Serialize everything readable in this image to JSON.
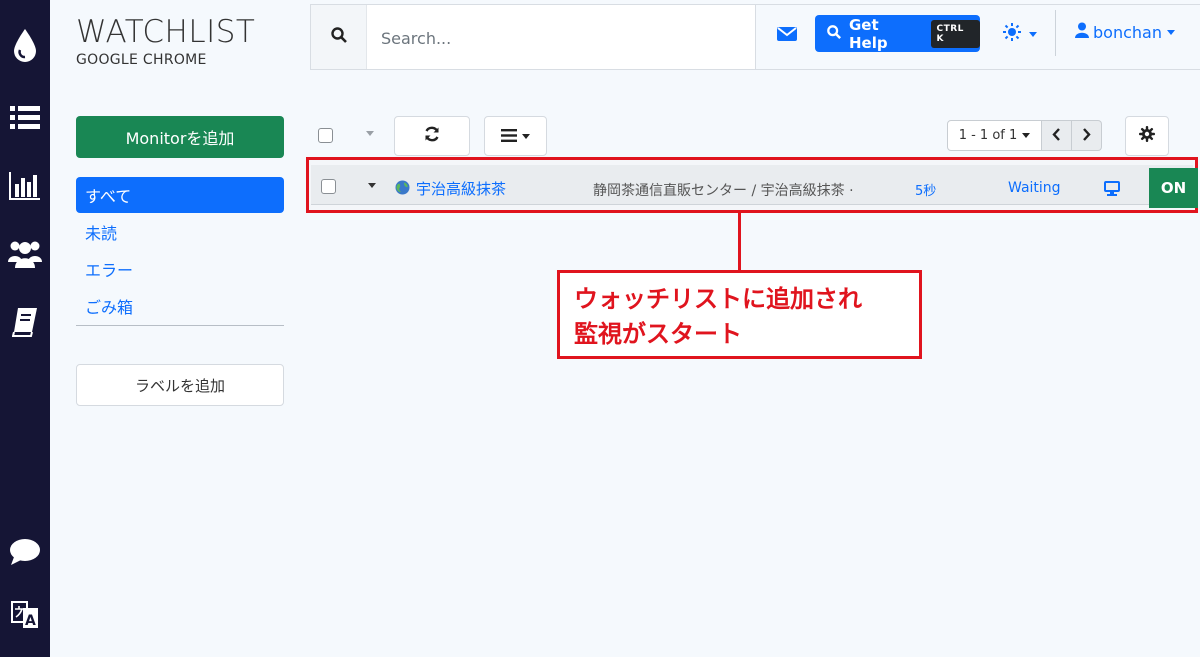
{
  "app": {
    "title": "WATCHLIST",
    "subtitle": "GOOGLE CHROME"
  },
  "rail": {
    "icons": [
      "droplet-logo-icon",
      "list-icon",
      "chart-icon",
      "users-icon",
      "book-icon",
      "chat-icon",
      "translate-icon"
    ]
  },
  "header": {
    "search_placeholder": "Search...",
    "help_label": "Get Help",
    "help_shortcut": "CTRL K",
    "username": "bonchan"
  },
  "sidebar": {
    "add_monitor_label": "Monitorを追加",
    "filters": [
      "すべて",
      "未読",
      "エラー",
      "ごみ箱"
    ],
    "active_filter": "すべて",
    "add_label_button": "ラベルを追加"
  },
  "toolbar": {
    "pagination": "1 - 1 of 1"
  },
  "rows": [
    {
      "title": "宇治高級抹茶",
      "url_text": "静岡茶通信直販センター / 宇治高級抹茶 ·",
      "interval": "5秒",
      "status": "Waiting",
      "toggle": "ON"
    }
  ],
  "annotation": {
    "line1": "ウォッチリストに追加され",
    "line2": "監視がスタート"
  },
  "colors": {
    "rail": "#151535",
    "primary": "#0d6efd",
    "success": "#198754",
    "annotation_red": "#e0141e"
  }
}
